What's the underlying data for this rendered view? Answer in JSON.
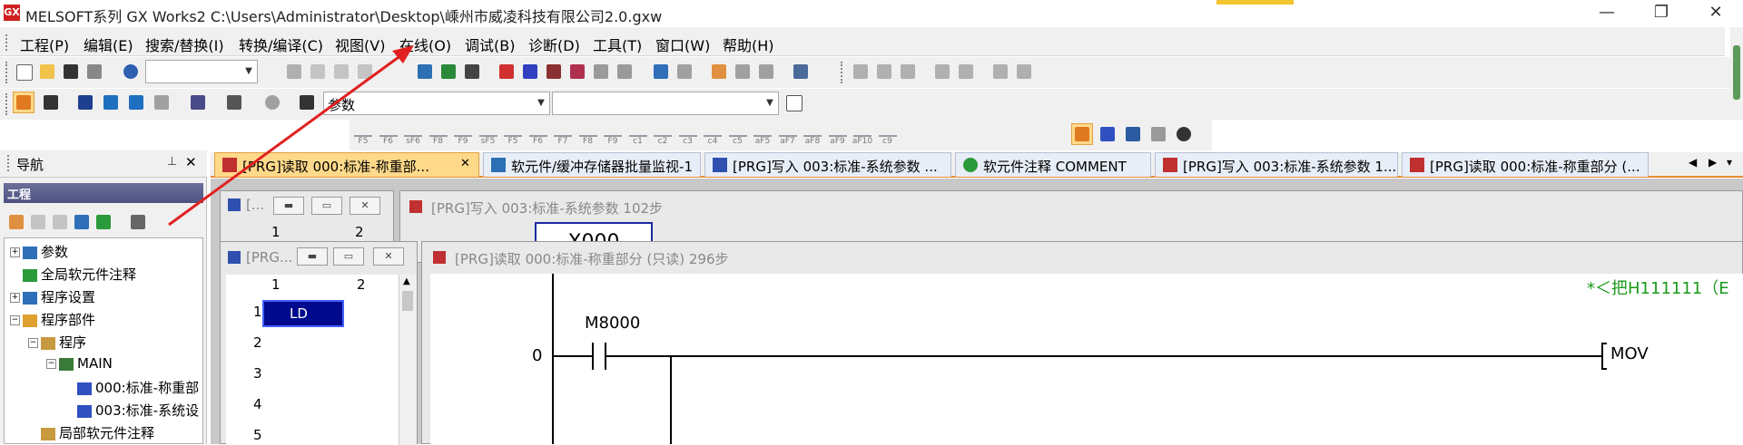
{
  "window": {
    "title": "MELSOFT系列 GX Works2 C:\\Users\\Administrator\\Desktop\\嵊州市威凌科技有限公司2.0.gxw",
    "app_icon": "GX",
    "minimize_icon": "—",
    "restore_icon": "❐",
    "close_icon": "✕"
  },
  "menu": {
    "items": [
      "工程(P)",
      "编辑(E)",
      "搜索/替换(I)",
      "转换/编译(C)",
      "视图(V)",
      "在线(O)",
      "调试(B)",
      "诊断(D)",
      "工具(T)",
      "窗口(W)",
      "帮助(H)"
    ]
  },
  "toolbar": {
    "combo1_value": "",
    "combo2_value": "参数",
    "combo3_value": ""
  },
  "fkeys": {
    "labels": [
      "F5",
      "F6",
      "sF6",
      "F8",
      "F9",
      "sF5",
      "F5",
      "F6",
      "F7",
      "F8",
      "F9",
      "c1",
      "c2",
      "c3",
      "c4",
      "c5",
      "aF5",
      "aF7",
      "aF8",
      "aF9",
      "aF10",
      "c9"
    ]
  },
  "nav": {
    "title": "导航",
    "pin_icon": "📌",
    "close_icon": "✕",
    "section": "工程",
    "tree": [
      {
        "label": "参数",
        "level": 0,
        "exp": "+"
      },
      {
        "label": "全局软元件注释",
        "level": 0,
        "exp": ""
      },
      {
        "label": "程序设置",
        "level": 0,
        "exp": "+"
      },
      {
        "label": "程序部件",
        "level": 0,
        "exp": "−"
      },
      {
        "label": "程序",
        "level": 1,
        "exp": "−"
      },
      {
        "label": "MAIN",
        "level": 2,
        "exp": "−"
      },
      {
        "label": "000:标准-称重部",
        "level": 3,
        "exp": ""
      },
      {
        "label": "003:标准-系统设",
        "level": 3,
        "exp": ""
      },
      {
        "label": "局部软元件注释",
        "level": 1,
        "exp": ""
      }
    ]
  },
  "tabs": [
    {
      "label": "[PRG]读取 000:标准-称重部...",
      "active": true,
      "close": "✕"
    },
    {
      "label": "软元件/缓冲存储器批量监视-1",
      "active": false
    },
    {
      "label": "[PRG]写入 003:标准-系统参数 ...",
      "active": false
    },
    {
      "label": "软元件注释 COMMENT",
      "active": false
    },
    {
      "label": "[PRG]写入 003:标准-系统参数 1...",
      "active": false
    },
    {
      "label": "[PRG]读取 000:标准-称重部分 (...",
      "active": false
    }
  ],
  "tab_nav": {
    "left": "◀",
    "right": "▶",
    "menu": "▾"
  },
  "windows": {
    "small1": {
      "title": "[...",
      "col1": "1",
      "col2": "2",
      "row1": "1"
    },
    "back_title": "[PRG]写入 003:标准-系统参数 102步",
    "back_cell": "X000",
    "small2": {
      "title": "[PRG...",
      "col1": "1",
      "col2": "2",
      "rows": [
        "1",
        "2",
        "3",
        "4",
        "5"
      ],
      "cell": "LD"
    },
    "front_title": "[PRG]读取 000:标准-称重部分 (只读) 296步"
  },
  "ladder": {
    "comment": "*＜把H111111（E",
    "step": "0",
    "contact": "M8000",
    "instruction": "MOV"
  },
  "colors": {
    "accent_orange": "#e88a2a",
    "active_tab": "#ffd98a",
    "selection_blue": "#000a8c",
    "comment_green": "#1a9a1a",
    "annotation_red": "#e02020"
  }
}
